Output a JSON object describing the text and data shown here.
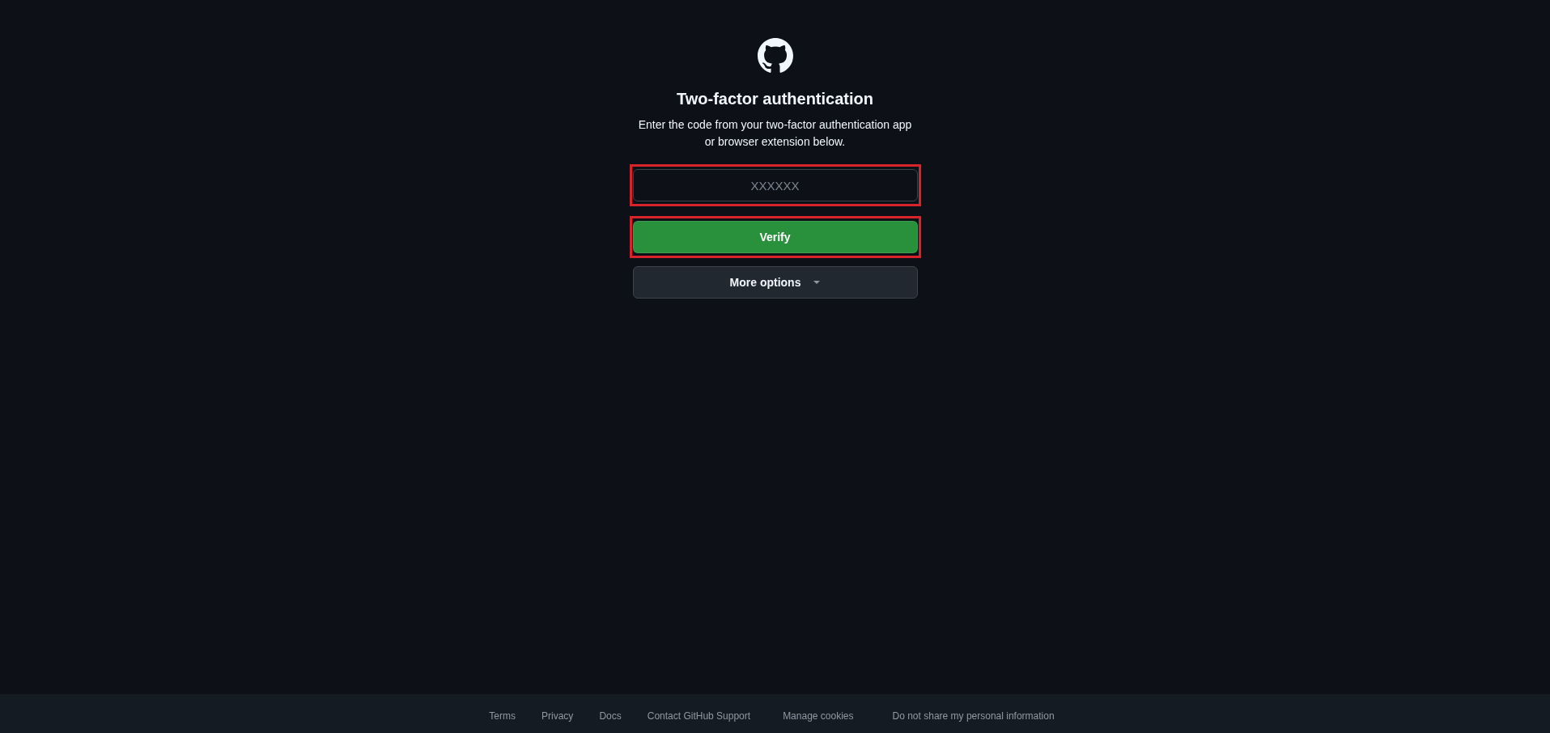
{
  "title": "Two-factor authentication",
  "instructions": "Enter the code from your two-factor authentication app\nor browser extension below.",
  "code_field": {
    "placeholder": "XXXXXX",
    "highlighted": true
  },
  "verify_button": {
    "label": "Verify",
    "highlighted": true
  },
  "more_options_button": {
    "label": "More options",
    "highlighted": false
  },
  "footer": {
    "links": [
      {
        "label": "Terms",
        "kind": "link"
      },
      {
        "label": "Privacy",
        "kind": "link"
      },
      {
        "label": "Docs",
        "kind": "link"
      },
      {
        "label": "Contact GitHub Support",
        "kind": "link"
      },
      {
        "label": "Manage cookies",
        "kind": "button"
      },
      {
        "label": "Do not share my personal information",
        "kind": "button"
      }
    ]
  }
}
